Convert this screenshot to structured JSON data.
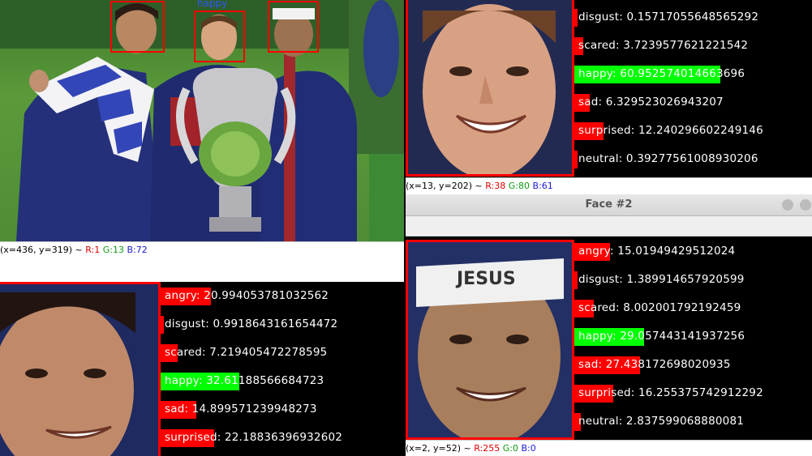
{
  "main_window": {
    "status": {
      "coords": "(x=436, y=319) ~ ",
      "r": "R:1",
      "g": "G:13",
      "b": "B:72"
    },
    "photo_label": "happy"
  },
  "face1_window": {
    "status": {
      "coords": "(x=13, y=202) ~ ",
      "r": "R:38",
      "g": "G:80",
      "b": "B:61"
    },
    "emotions": [
      {
        "label": "disgust: 0.15717055648565292",
        "value": 0.157
      },
      {
        "label": "scared: 3.7239577621221542",
        "value": 3.72
      },
      {
        "label": "happy: 60.952574014663696",
        "value": 60.95
      },
      {
        "label": "sad: 6.329523026943207",
        "value": 6.33
      },
      {
        "label": "surprised: 12.240296602249146",
        "value": 12.24
      },
      {
        "label": "neutral: 0.39277561008930206",
        "value": 0.39
      }
    ]
  },
  "face0_window": {
    "emotions": [
      {
        "label": "angry: 20.994053781032562",
        "value": 20.99
      },
      {
        "label": "disgust: 0.9918643161654472",
        "value": 0.99
      },
      {
        "label": "scared: 7.219405472278595",
        "value": 7.22
      },
      {
        "label": "happy: 32.61188566684723",
        "value": 32.61
      },
      {
        "label": "sad: 14.899571239948273",
        "value": 14.9
      },
      {
        "label": "surprised: 22.18836396932602",
        "value": 22.19
      }
    ]
  },
  "face2_window": {
    "title": "Face #2",
    "status": {
      "coords": "(x=2, y=52) ~ ",
      "r": "R:255",
      "g": "G:0",
      "b": "B:0"
    },
    "emotions": [
      {
        "label": "angry: 15.01949429512024",
        "value": 15.02
      },
      {
        "label": "disgust: 1.389914657920599",
        "value": 1.39
      },
      {
        "label": "scared: 8.002001792192459",
        "value": 8.0
      },
      {
        "label": "happy: 29.057443141937256",
        "value": 29.06
      },
      {
        "label": "sad: 27.438172698020935",
        "value": 27.44
      },
      {
        "label": "surprised: 16.255375742912292",
        "value": 16.26
      },
      {
        "label": "neutral: 2.837599068880081",
        "value": 2.84
      }
    ]
  },
  "colors": {
    "bar_default": "#ff0000",
    "bar_max": "#00ff00",
    "face_box": "#ff0000",
    "status_r": "#e00000",
    "status_g": "#119911",
    "status_b": "#1a1ad6"
  }
}
